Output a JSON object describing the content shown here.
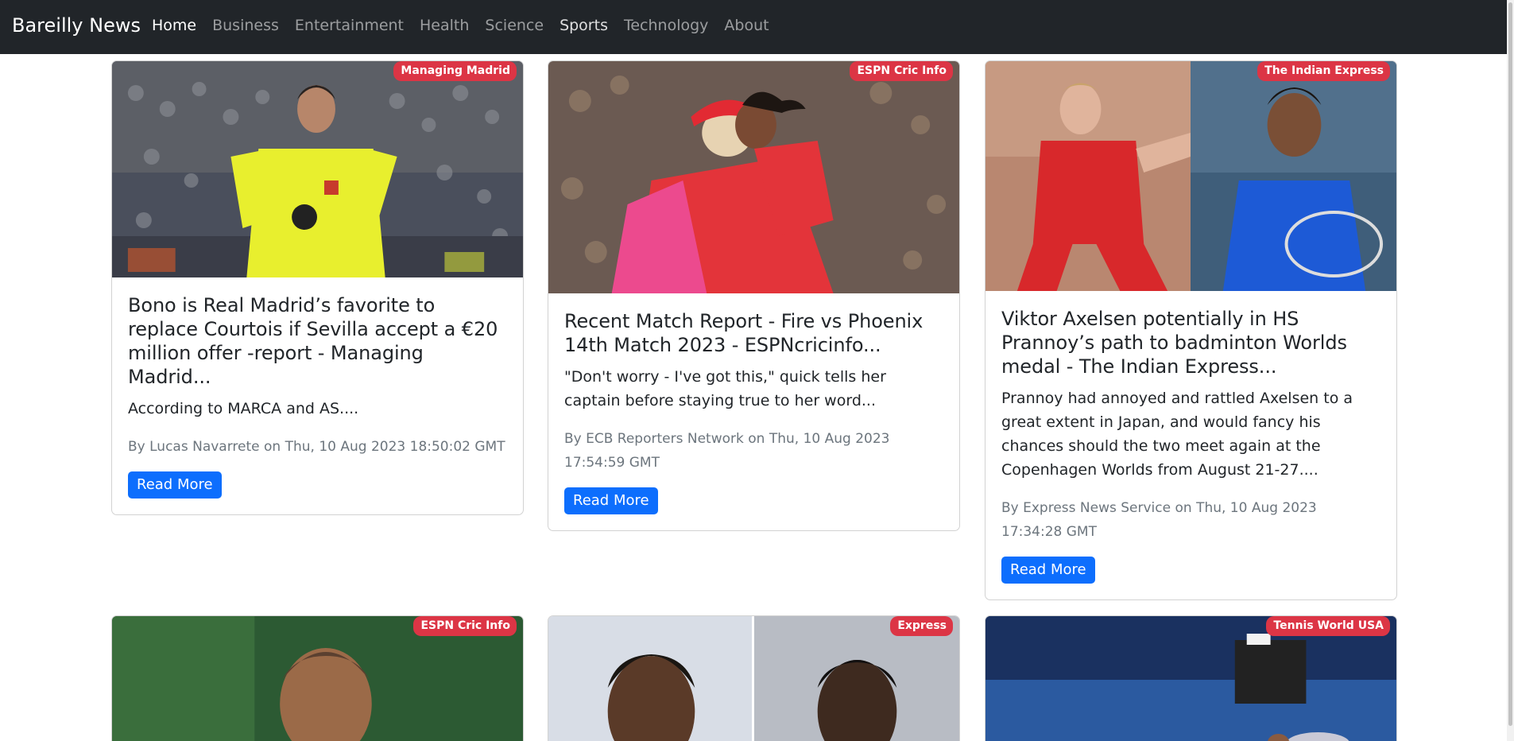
{
  "brand": "Bareilly News",
  "nav": {
    "items": [
      {
        "label": "Home"
      },
      {
        "label": "Business"
      },
      {
        "label": "Entertainment"
      },
      {
        "label": "Health"
      },
      {
        "label": "Science"
      },
      {
        "label": "Sports"
      },
      {
        "label": "Technology"
      },
      {
        "label": "About"
      }
    ]
  },
  "colors": {
    "navbar_bg": "#212529",
    "badge": "#dc3545",
    "button": "#0d6efd",
    "meta_text": "#6c757d"
  },
  "articles": [
    {
      "source": "Managing Madrid",
      "title": "Bono is Real Madrid’s favorite to replace Courtois if Sevilla accept a €20 million offer -report - Managing Madrid...",
      "description": "According to MARCA and AS....",
      "meta": "By Lucas Navarrete on Thu, 10 Aug 2023 18:50:02 GMT",
      "button": "Read More"
    },
    {
      "source": "ESPN Cric Info",
      "title": "Recent Match Report - Fire vs Phoenix 14th Match 2023 - ESPNcricinfo...",
      "description": "\"Don't worry - I've got this,\" quick tells her captain before staying true to her word...",
      "meta": "By ECB Reporters Network on Thu, 10 Aug 2023 17:54:59 GMT",
      "button": "Read More"
    },
    {
      "source": "The Indian Express",
      "title": "Viktor Axelsen potentially in HS Prannoy’s path to badminton Worlds medal - The Indian Express...",
      "description": "Prannoy had annoyed and rattled Axelsen to a great extent in Japan, and would fancy his chances should the two meet again at the Copenhagen Worlds from August 21-27....",
      "meta": "By Express News Service on Thu, 10 Aug 2023 17:34:28 GMT",
      "button": "Read More"
    },
    {
      "source": "ESPN Cric Info"
    },
    {
      "source": "Express"
    },
    {
      "source": "Tennis World USA"
    }
  ]
}
